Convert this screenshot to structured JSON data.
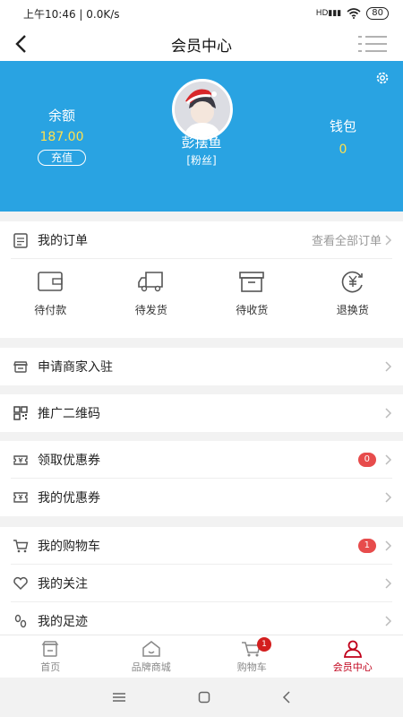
{
  "status": {
    "time": "上午10:46 | 0.0K/s",
    "battery": "80"
  },
  "header": {
    "title": "会员中心"
  },
  "profile": {
    "balance_label": "余额",
    "balance_value": "187.00",
    "recharge_label": "充值",
    "username": "彭摆鱼",
    "user_tag": "[粉丝]",
    "wallet_label": "钱包",
    "wallet_value": "0"
  },
  "orders": {
    "title": "我的订单",
    "view_all": "查看全部订单",
    "items": [
      {
        "label": "待付款",
        "icon": "wallet-icon"
      },
      {
        "label": "待发货",
        "icon": "truck-icon"
      },
      {
        "label": "待收货",
        "icon": "box-icon"
      },
      {
        "label": "退换货",
        "icon": "yen-refresh-icon"
      }
    ]
  },
  "menu": {
    "merchant": "申请商家入驻",
    "qrcode": "推广二维码",
    "get_coupon": "领取优惠券",
    "get_coupon_count": "0",
    "my_coupon": "我的优惠券",
    "cart": "我的购物车",
    "cart_count": "1",
    "follow": "我的关注",
    "footprint": "我的足迹"
  },
  "tabbar": {
    "home": "首页",
    "brand": "品牌商城",
    "cart": "购物车",
    "cart_badge": "1",
    "member": "会员中心"
  },
  "colors": {
    "primary": "#29a3e2",
    "accent": "#c0001a",
    "badge": "#e74c4c",
    "value": "#ffe14d"
  }
}
